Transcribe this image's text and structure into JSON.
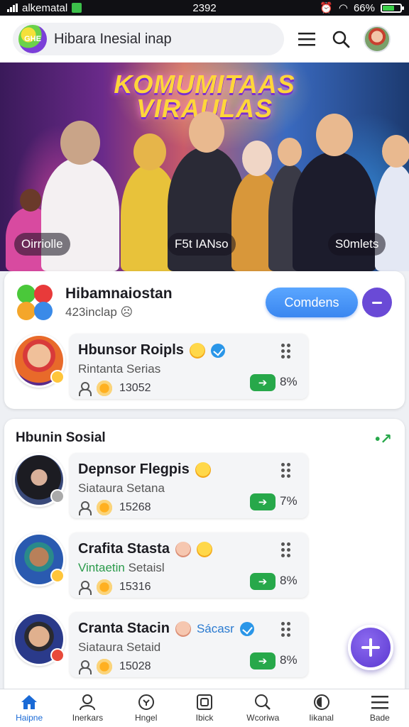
{
  "status_bar": {
    "carrier": "alkematal",
    "time": "2392",
    "battery": "66%",
    "battery_level": 0.66
  },
  "header": {
    "search_text": "Hibara Inesial inap",
    "logo_text": "GHE"
  },
  "hero": {
    "title_line1": "KOMUMITAAS",
    "title_line2": "VIRAULAS",
    "chips": [
      "Oirriolle",
      "F5t IANso",
      "S0mlets"
    ]
  },
  "community_card": {
    "name": "Hibamnaiostan",
    "meta": "423inclap",
    "connect_label": "Comdens",
    "featured": {
      "title": "Hbunsor Roipls",
      "subtitle": "Rintanta Serias",
      "count": "13052",
      "percent": "8%"
    }
  },
  "social_section": {
    "title": "Hbunin Sosial",
    "items": [
      {
        "title": "Depnsor Flegpis",
        "subtitle": "Siataura Setana",
        "count": "15268",
        "percent": "7%"
      },
      {
        "title": "Crafita Stasta",
        "subtitle_green": "Vintaetin",
        "subtitle_rest": "Setaisl",
        "count": "15316",
        "percent": "8%"
      },
      {
        "title": "Cranta Stacin",
        "tag": "Sácasr",
        "subtitle": "Siataura Setaid",
        "count": "15028",
        "percent": "8%"
      }
    ]
  },
  "bottom_nav": {
    "items": [
      "Haipne",
      "Inerkars",
      "Hngel",
      "Ibick",
      "Wcoriwa",
      "Iikanal",
      "Bade"
    ]
  },
  "colors": {
    "accent_blue": "#3a86f0",
    "accent_purple": "#6a4ad6",
    "go_green": "#27a84a"
  }
}
